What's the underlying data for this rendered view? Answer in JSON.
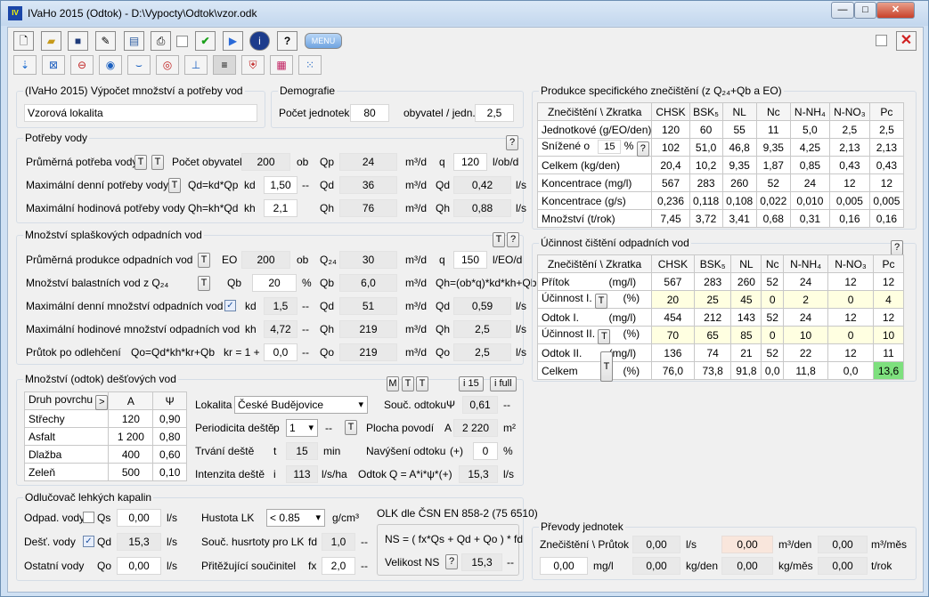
{
  "window": {
    "title": "IVaHo 2015 (Odtok) - D:\\Vypocty\\Odtok\\vzor.odk",
    "btn_min": "—",
    "btn_max": "□",
    "btn_close": "✕"
  },
  "toolbar": {
    "menu_label": "MENU"
  },
  "calc": {
    "group_title": "(IVaHo 2015) Výpočet množství a potřeby vod",
    "locality": "Vzorová lokalita"
  },
  "demo": {
    "group_title": "Demografie",
    "units_label": "Počet jednotek",
    "units_value": "80",
    "per_label": "obyvatel / jedn.",
    "per_value": "2,5"
  },
  "needs": {
    "group_title": "Potřeby vody",
    "help": "?",
    "avg_label": "Průměrná potřeba vody",
    "t1": "T",
    "t2": "T",
    "pop_label": "Počet obyvatel",
    "pop": "200",
    "ob": "ob",
    "qp_label": "Qp",
    "qp": "24",
    "unit_m3d": "m³/d",
    "q_label": "q",
    "q": "120",
    "q_unit": "l/ob/d",
    "maxd_label": "Maximální denní potřeby vody",
    "t3": "T",
    "qd_formula": "Qd=kd*Qp",
    "kd_label": "kd",
    "kd": "1,50",
    "dash": "--",
    "qd_label": "Qd",
    "qd": "36",
    "qd_unit": "m³/d",
    "qd2_label": "Qd",
    "qd2": "0,42",
    "ls": "l/s",
    "maxh_label": "Maximální hodinová potřeby vody",
    "qh_formula": "Qh=kh*Qd",
    "kh_label": "kh",
    "kh": "2,1",
    "qh_label": "Qh",
    "qh": "76",
    "qh_unit": "m³/d",
    "qh2_label": "Qh",
    "qh2": "0,88"
  },
  "waste": {
    "group_title": "Množství splaškových odpadních vod",
    "t": "T",
    "help": "?",
    "avg_label": "Průměrná produkce odpadních vod",
    "t1": "T",
    "eo_label": "EO",
    "eo": "200",
    "ob": "ob",
    "q24_label": "Q₂₄",
    "q24": "30",
    "unit_m3d": "m³/d",
    "q_label": "q",
    "q": "150",
    "q_unit": "l/EO/d",
    "bal_label": "Množství balastních vod z Q₂₄",
    "t2": "T",
    "qb_label": "Qb",
    "qb_pct": "20",
    "pct": "%",
    "qb2_label": "Qb",
    "qb": "6,0",
    "qb_unit": "m³/d",
    "qh_formula": "Qh=(ob*q)*kd*kh+Qb",
    "maxd_label": "Maximální denní množství odpadních vod",
    "kd_label": "kd",
    "kd": "1,5",
    "dash": "--",
    "qd_label": "Qd",
    "qd": "51",
    "qd_unit": "m³/d",
    "qd2_label": "Qd",
    "qd2": "0,59",
    "ls": "l/s",
    "maxh_label": "Maximální hodinové množství odpadních vod",
    "kh_label": "kh",
    "kh": "4,72",
    "qh_label": "Qh",
    "qh": "219",
    "qh_unit": "m³/d",
    "qh2_label": "Qh",
    "qh2": "2,5",
    "flow_label": "Průtok po odlehčení",
    "qo_formula": "Qo=Qd*kh*kr+Qb",
    "kr_label": "kr = 1 +",
    "kr": "0,0",
    "qo_label": "Qo",
    "qo": "219",
    "qo_unit": "m³/d",
    "qo2_label": "Qo",
    "qo2": "2,5"
  },
  "rain": {
    "group_title": "Množství (odtok) dešťových vod",
    "m": "M",
    "t1": "T",
    "t2": "T",
    "i15": "i 15",
    "ifull": "i full",
    "col_surface": "Druh povrchu",
    "col_arrow": ">",
    "col_a": "A",
    "col_psi": "Ψ",
    "rows": [
      {
        "name": "Střechy",
        "a": "120",
        "psi": "0,90"
      },
      {
        "name": "Asfalt",
        "a": "1 200",
        "psi": "0,80"
      },
      {
        "name": "Dlažba",
        "a": "400",
        "psi": "0,60"
      },
      {
        "name": "Zeleň",
        "a": "500",
        "psi": "0,10"
      }
    ],
    "locality_label": "Lokalita",
    "locality": "České Budějovice",
    "coef_label": "Souč. odtoku",
    "psi_sym": "Ψ",
    "coef": "0,61",
    "dash": "--",
    "period_label": "Periodicita deště",
    "p": "p",
    "period": "1",
    "t3": "T",
    "area_label": "Plocha povodí",
    "a_sym": "A",
    "area": "2 220",
    "area_unit": "m²",
    "dur_label": "Trvání deště",
    "t": "t",
    "dur": "15",
    "min": "min",
    "inc_label": "Navýšení odtoku",
    "plus": "(+)",
    "inc": "0",
    "pct": "%",
    "int_label": "Intenzita deště",
    "i": "i",
    "int": "113",
    "int_unit": "l/s/ha",
    "out_label": "Odtok",
    "out_formula": "Q = A*i*ψ*(+)",
    "out": "15,3",
    "ls": "l/s"
  },
  "sep": {
    "group_title": "Odlučovač lehkých kapalin",
    "w1_label": "Odpad. vody",
    "qs_label": "Qs",
    "qs": "0,00",
    "ls": "l/s",
    "dens_label": "Hustota LK",
    "dens": "< 0.85",
    "dens_unit": "g/cm³",
    "w2_label": "Dešť. vody",
    "qd_label": "Qd",
    "qd": "15,3",
    "fd_label": "Souč. husrtoty pro LK",
    "fd_sym": "fd",
    "fd": "1,0",
    "dash": "--",
    "w3_label": "Ostatní vody",
    "qo_label": "Qo",
    "qo": "0,00",
    "fx_label": "Přitěžující součinitel",
    "fx_sym": "fx",
    "fx": "2,0",
    "olk_title": "OLK dle ČSN EN 858-2 (75 6510)",
    "formula": "NS = ( fx*Qs + Qd + Qo ) * fd",
    "ns_label": "Velikost NS",
    "help": "?",
    "ns": "15,3"
  },
  "spec": {
    "group_title": "Produkce specifického znečištění (z Q₂₄+Qb a EO)",
    "head": [
      "Znečištění  \\  Zkratka",
      "CHSK",
      "BSK₅",
      "NL",
      "Nc",
      "N-NH₄",
      "N-NO₃",
      "Pc"
    ],
    "rows": [
      [
        "Jednotkové (g/EO/den)",
        "120",
        "60",
        "55",
        "11",
        "5,0",
        "2,5",
        "2,5"
      ],
      [
        "Snížené o",
        "102",
        "51,0",
        "46,8",
        "9,35",
        "4,25",
        "2,13",
        "2,13"
      ],
      [
        "Celkem        (kg/den)",
        "20,4",
        "10,2",
        "9,35",
        "1,87",
        "0,85",
        "0,43",
        "0,43"
      ],
      [
        "Koncentrace        (mg/l)",
        "567",
        "283",
        "260",
        "52",
        "24",
        "12",
        "12"
      ],
      [
        "Koncentrace        (g/s)",
        "0,236",
        "0,118",
        "0,108",
        "0,022",
        "0,010",
        "0,005",
        "0,005"
      ],
      [
        "Množství       (t/rok)",
        "7,45",
        "3,72",
        "3,41",
        "0,68",
        "0,31",
        "0,16",
        "0,16"
      ]
    ],
    "reduce_pct": "15",
    "pct": "%",
    "help": "?"
  },
  "eff": {
    "group_title": "Účinnost čištění odpadních vod",
    "help": "?",
    "head": [
      "Znečištění  \\  Zkratka",
      "CHSK",
      "BSK₅",
      "NL",
      "Nc",
      "N-NH₄",
      "N-NO₃",
      "Pc"
    ],
    "rows": [
      {
        "name": "Přítok",
        "unit": "(mg/l)",
        "v": [
          "567",
          "283",
          "260",
          "52",
          "24",
          "12",
          "12"
        ]
      },
      {
        "name": "Účinnost I.",
        "unit": "(%)",
        "v": [
          "20",
          "25",
          "45",
          "0",
          "2",
          "0",
          "4"
        ]
      },
      {
        "name": "Odtok I.",
        "unit": "(mg/l)",
        "v": [
          "454",
          "212",
          "143",
          "52",
          "24",
          "12",
          "12"
        ]
      },
      {
        "name": "Účinnost II.",
        "unit": "(%)",
        "v": [
          "70",
          "65",
          "85",
          "0",
          "10",
          "0",
          "10"
        ]
      },
      {
        "name": "Odtok II.",
        "unit": "(mg/l)",
        "v": [
          "136",
          "74",
          "21",
          "52",
          "22",
          "12",
          "11"
        ]
      },
      {
        "name": "Celkem",
        "unit": "(%)",
        "v": [
          "76,0",
          "73,8",
          "91,8",
          "0,0",
          "11,8",
          "0,0",
          "13,6"
        ]
      }
    ],
    "t": "T"
  },
  "conv": {
    "group_title": "Převody jednotek",
    "label": "Znečištění \\ Průtok",
    "v1": "0,00",
    "u1": "l/s",
    "v2": "0,00",
    "u2": "m³/den",
    "v3": "0,00",
    "u3": "m³/měs",
    "v4": "0,00",
    "u4": "mg/l",
    "v5": "0,00",
    "u5": "kg/den",
    "v6": "0,00",
    "u6": "kg/měs",
    "v7": "0,00",
    "u7": "t/rok"
  }
}
